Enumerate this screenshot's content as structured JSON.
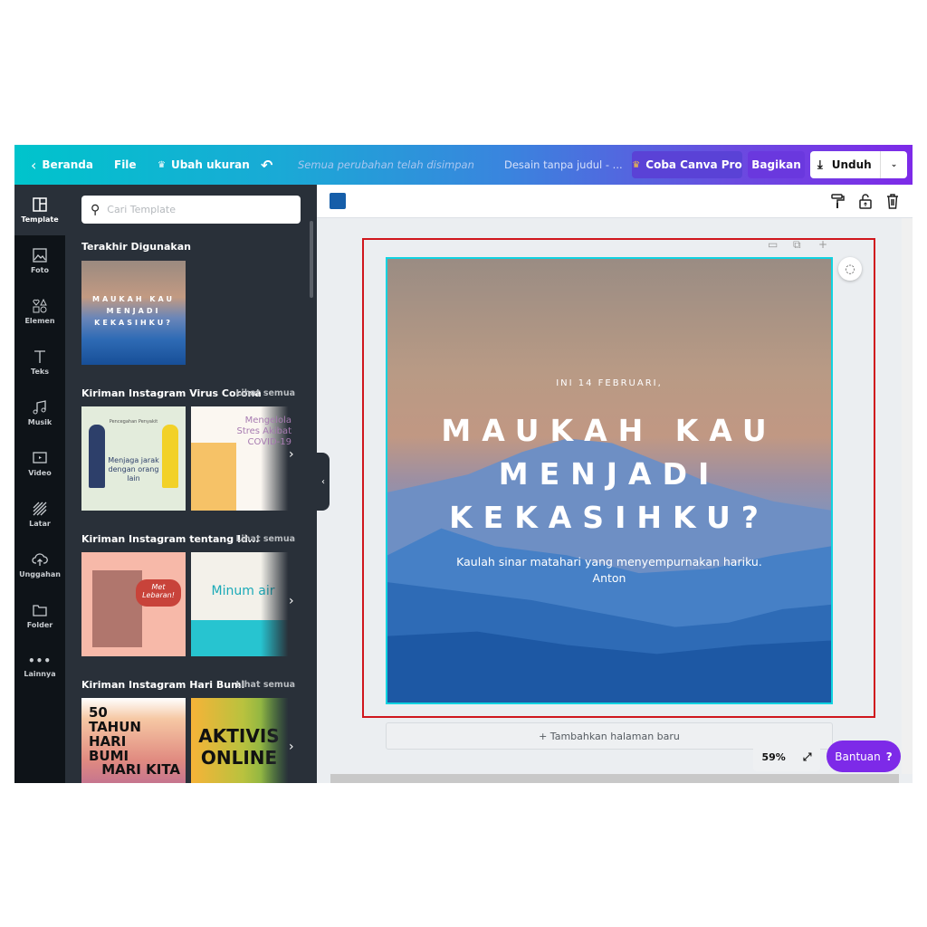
{
  "topbar": {
    "home": "Beranda",
    "file": "File",
    "resize": "Ubah ukuran",
    "save_status": "Semua perubahan telah disimpan",
    "title": "Desain tanpa judul -   ...",
    "pro": "Coba Canva Pro",
    "share": "Bagikan",
    "download": "Unduh"
  },
  "rail": [
    {
      "label": "Template",
      "icon": "template-icon"
    },
    {
      "label": "Foto",
      "icon": "photo-icon"
    },
    {
      "label": "Elemen",
      "icon": "elements-icon"
    },
    {
      "label": "Teks",
      "icon": "text-icon"
    },
    {
      "label": "Musik",
      "icon": "music-icon"
    },
    {
      "label": "Video",
      "icon": "video-icon"
    },
    {
      "label": "Latar",
      "icon": "background-icon"
    },
    {
      "label": "Unggahan",
      "icon": "upload-icon"
    },
    {
      "label": "Folder",
      "icon": "folder-icon"
    },
    {
      "label": "Lainnya",
      "icon": "more-icon"
    }
  ],
  "panel": {
    "search_placeholder": "Cari Template",
    "recent_title": "Terakhir Digunakan",
    "recent_thumb": {
      "title": "MAUKAH KAU MENJADI KEKASIHKU?"
    },
    "see_all": "Lihat semua",
    "sections": [
      {
        "title": "Kiriman Instagram Virus Corona",
        "thumbs": [
          {
            "title": "Menjaga jarak dengan orang lain",
            "sub": "Pencegahan Penyakit"
          },
          {
            "title": "Mengelola Stres Akibat COVID-19"
          }
        ]
      },
      {
        "title": "Kiriman Instagram tentang Id...",
        "thumbs": [
          {
            "title": "Met Lebaran!"
          },
          {
            "title": "Minum air"
          }
        ]
      },
      {
        "title": "Kiriman Instagram Hari Bumi",
        "thumbs": [
          {
            "title": "50 TAHUN HARI BUMI",
            "sub": "MARI KITA"
          },
          {
            "title": "AKTIVIS ONLINE"
          }
        ]
      }
    ]
  },
  "toolbar": {
    "color": "#155ea9"
  },
  "design": {
    "eyebrow": "INI 14 FEBRUARI,",
    "headline": [
      "MAUKAH KAU",
      "MENJADI",
      "KEKASIHKU?"
    ],
    "body": "Kaulah sinar matahari yang menyempurnakan hariku.",
    "signature": "Anton"
  },
  "add_page": "+ Tambahkan halaman baru",
  "zoom": "59%",
  "help": "Bantuan",
  "help_icon": "?",
  "colors": {
    "accent": "#7d2ae8",
    "selection": "#10d2e0",
    "frame": "#d0161d"
  }
}
